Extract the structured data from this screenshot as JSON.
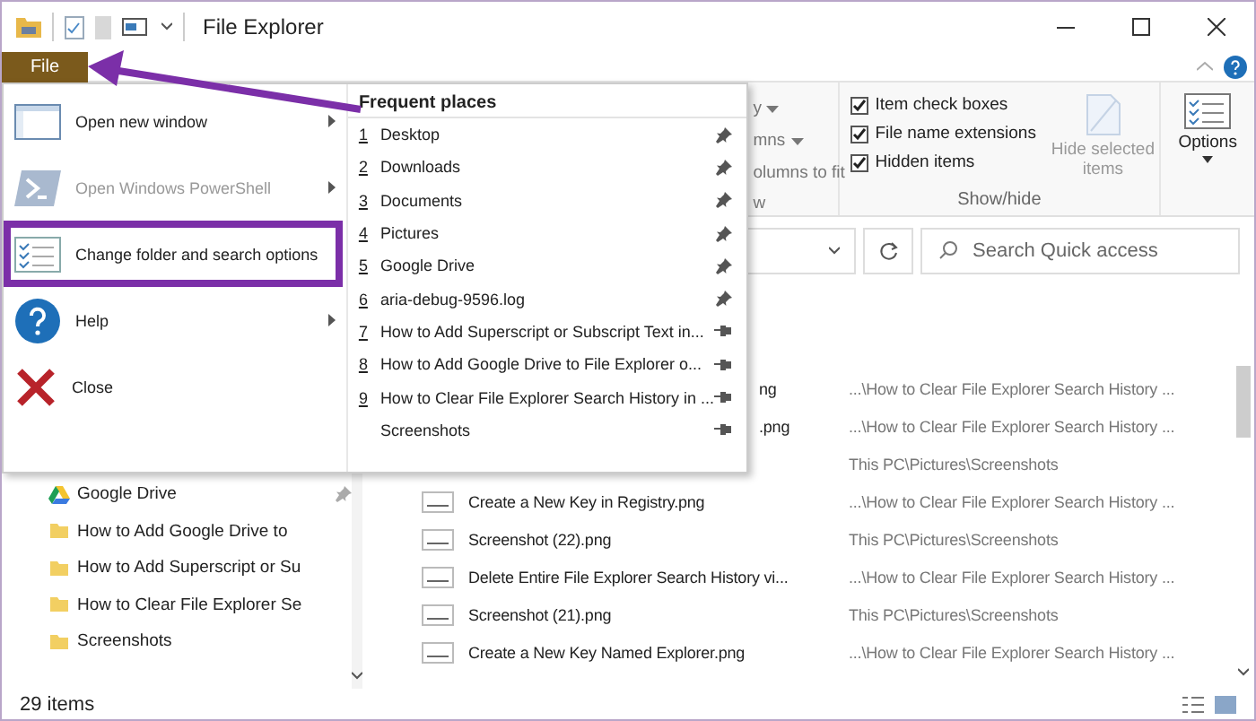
{
  "window": {
    "title": "File Explorer"
  },
  "ribbon": {
    "file_tab": "File",
    "view_fragments": [
      {
        "text": "y",
        "caret": true
      },
      {
        "text": "mns",
        "caret": true
      },
      {
        "text": "olumns to fit",
        "caret": false
      }
    ],
    "view_group_fragment": "w",
    "show_hide": {
      "options": [
        {
          "label": "Item check boxes",
          "checked": true
        },
        {
          "label": "File name extensions",
          "checked": true
        },
        {
          "label": "Hidden items",
          "checked": true
        }
      ],
      "hide_selected": "Hide selected items",
      "group_label": "Show/hide"
    },
    "options_button": "Options"
  },
  "search": {
    "placeholder": "Search Quick access"
  },
  "file_menu": {
    "commands": [
      {
        "kind": "window",
        "label": "Open new window",
        "submenu": true,
        "disabled": false
      },
      {
        "kind": "shell",
        "label": "Open Windows PowerShell",
        "submenu": true,
        "disabled": true
      },
      {
        "kind": "options",
        "label": "Change folder and search options",
        "submenu": false,
        "disabled": false
      },
      {
        "kind": "help",
        "label": "Help",
        "submenu": true,
        "disabled": false
      },
      {
        "kind": "close",
        "label": "Close",
        "submenu": false,
        "disabled": false
      }
    ],
    "frequent_title": "Frequent places",
    "frequent": [
      {
        "number": "1",
        "label": "Desktop",
        "pinned": true
      },
      {
        "number": "2",
        "label": "Downloads",
        "pinned": true
      },
      {
        "number": "3",
        "label": "Documents",
        "pinned": true
      },
      {
        "number": "4",
        "label": "Pictures",
        "pinned": true
      },
      {
        "number": "5",
        "label": "Google Drive",
        "pinned": true
      },
      {
        "number": "6",
        "label": "aria-debug-9596.log",
        "pinned": true
      },
      {
        "number": "7",
        "label": "How to Add Superscript or Subscript Text in...",
        "pinned": false
      },
      {
        "number": "8",
        "label": "How to Add Google Drive to File Explorer o...",
        "pinned": false
      },
      {
        "number": "9",
        "label": "How to Clear File Explorer Search History in ...",
        "pinned": false
      },
      {
        "label": "Screenshots",
        "pinned": false
      }
    ]
  },
  "nav_pane": {
    "items": [
      {
        "kind": "drive",
        "label": "Google Drive",
        "pinned": true
      },
      {
        "kind": "folder",
        "label": "How to Add Google Drive to",
        "pinned": false
      },
      {
        "kind": "folder",
        "label": "How to Add Superscript or Su",
        "pinned": false
      },
      {
        "kind": "folder",
        "label": "How to Clear File Explorer Se",
        "pinned": false
      },
      {
        "kind": "folder",
        "label": "Screenshots",
        "pinned": false
      }
    ]
  },
  "files": [
    {
      "name": "ng",
      "location": "...\\How to Clear File Explorer Search History ...",
      "covered": true
    },
    {
      "name": ".png",
      "location": "...\\How to Clear File Explorer Search History ...",
      "covered": true
    },
    {
      "location": "This PC\\Pictures\\Screenshots",
      "covered": true
    },
    {
      "name": "Create a New Key in Registry.png",
      "location": "...\\How to Clear File Explorer Search History ...",
      "covered": false
    },
    {
      "name": "Screenshot (22).png",
      "location": "This PC\\Pictures\\Screenshots",
      "covered": false
    },
    {
      "name": "Delete Entire File Explorer Search History vi...",
      "location": "...\\How to Clear File Explorer Search History ...",
      "covered": false
    },
    {
      "name": "Screenshot (21).png",
      "location": "This PC\\Pictures\\Screenshots",
      "covered": false
    },
    {
      "name": "Create a New Key Named Explorer.png",
      "location": "...\\How to Clear File Explorer Search History ...",
      "covered": false
    }
  ],
  "status_bar": {
    "count": "29 items"
  },
  "annotations": {
    "arrow": true,
    "frame": true
  }
}
